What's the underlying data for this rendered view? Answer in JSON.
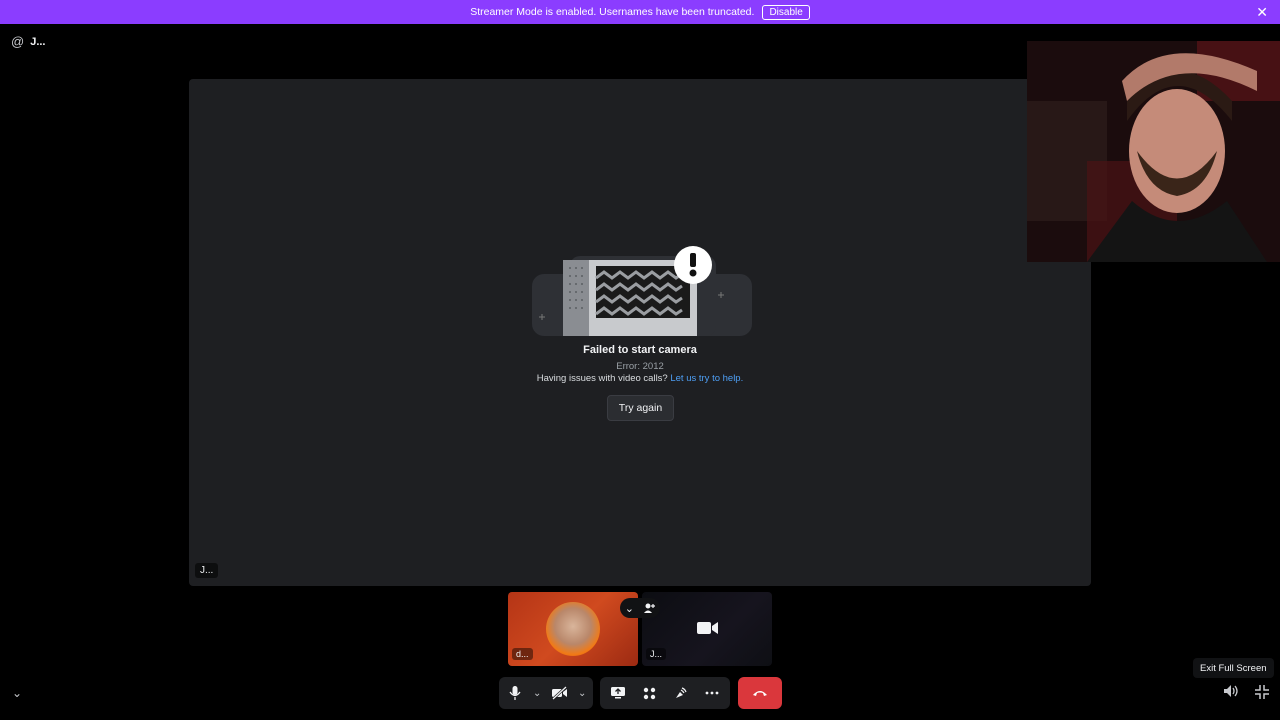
{
  "banner": {
    "text": "Streamer Mode is enabled. Usernames have been truncated.",
    "button_label": "Disable",
    "close_glyph": "✕"
  },
  "header": {
    "at_symbol": "@",
    "channel_name": "J..."
  },
  "main_panel": {
    "participant_name": "J...",
    "error_title": "Failed to start camera",
    "error_code": "Error: 2012",
    "help_text": "Having issues with video calls?",
    "help_link": "Let us try to help.",
    "retry_label": "Try again"
  },
  "tiles": [
    {
      "name": "d..."
    },
    {
      "name": "J..."
    }
  ],
  "tooltip": {
    "text": "Exit Full Screen"
  },
  "icons": {
    "collapse": "chevron-down-icon",
    "microphone": "microphone-icon",
    "camera": "camera-off-icon",
    "screenshare": "screen-share-icon",
    "activities": "activities-icon",
    "soundboard": "soundboard-icon",
    "more": "more-icon",
    "hangup": "hang-up-icon",
    "volume": "volume-icon",
    "exit_fullscreen": "exit-fullscreen-icon"
  },
  "colors": {
    "banner": "#8b3dff",
    "hangup": "#da373c",
    "link": "#4e9ff5",
    "panel": "#1e1f22"
  }
}
